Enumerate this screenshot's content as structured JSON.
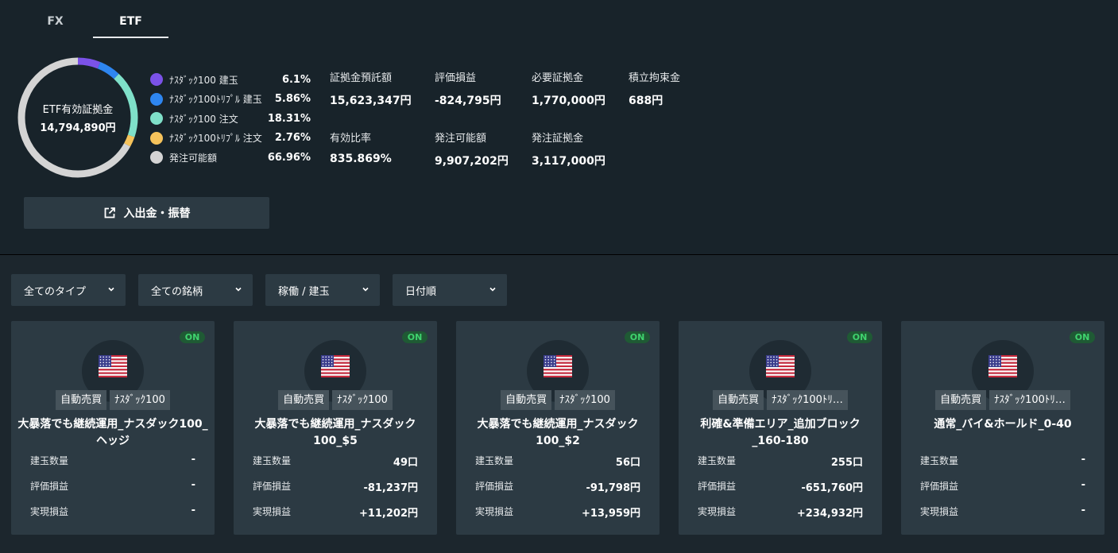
{
  "tabs": [
    {
      "label": "FX",
      "active": false
    },
    {
      "label": "ETF",
      "active": true
    }
  ],
  "donut": {
    "label": "ETF有効証拠金",
    "value": "14,794,890円",
    "segments": [
      {
        "name": "ﾅｽﾀﾞｯｸ100 建玉",
        "pct": "6.1%",
        "value": 6.1,
        "color": "#7b52e8"
      },
      {
        "name": "ﾅｽﾀﾞｯｸ100ﾄﾘﾌﾟﾙ 建玉",
        "pct": "5.86%",
        "value": 5.86,
        "color": "#2e86f0"
      },
      {
        "name": "ﾅｽﾀﾞｯｸ100 注文",
        "pct": "18.31%",
        "value": 18.31,
        "color": "#7fe0c9"
      },
      {
        "name": "ﾅｽﾀﾞｯｸ100ﾄﾘﾌﾟﾙ 注文",
        "pct": "2.76%",
        "value": 2.76,
        "color": "#f6c35b"
      },
      {
        "name": "発注可能額",
        "pct": "66.96%",
        "value": 66.96,
        "color": "#d4d4d4"
      }
    ]
  },
  "stats": {
    "deposit": {
      "label": "証拠金預託額",
      "value": "15,623,347円"
    },
    "unrealized": {
      "label": "評価損益",
      "value": "-824,795円"
    },
    "required": {
      "label": "必要証拠金",
      "value": "1,770,000円"
    },
    "reserve": {
      "label": "積立拘束金",
      "value": "688円"
    },
    "ratio": {
      "label": "有効比率",
      "value": "835.869%"
    },
    "available": {
      "label": "発注可能額",
      "value": "9,907,202円"
    },
    "order_margin": {
      "label": "発注証拠金",
      "value": "3,117,000円"
    }
  },
  "deposit_button": {
    "label": "入出金・振替",
    "icon": "external-link-icon"
  },
  "filters": [
    {
      "label": "全てのタイプ"
    },
    {
      "label": "全ての銘柄"
    },
    {
      "label": "稼働 / 建玉"
    },
    {
      "label": "日付順"
    }
  ],
  "cards": [
    {
      "status": "ON",
      "flag": "us-flag-icon",
      "tags": [
        "自動売買",
        "ﾅｽﾀﾞｯｸ100"
      ],
      "title": "大暴落でも継続運用_ナスダック100_ヘッジ",
      "rows": [
        {
          "label": "建玉数量",
          "value": "-"
        },
        {
          "label": "評価損益",
          "value": "-"
        },
        {
          "label": "実現損益",
          "value": "-"
        }
      ]
    },
    {
      "status": "ON",
      "flag": "us-flag-icon",
      "tags": [
        "自動売買",
        "ﾅｽﾀﾞｯｸ100"
      ],
      "title": "大暴落でも継続運用_ナスダック100_$5",
      "rows": [
        {
          "label": "建玉数量",
          "value": "49口"
        },
        {
          "label": "評価損益",
          "value": "-81,237円"
        },
        {
          "label": "実現損益",
          "value": "+11,202円"
        }
      ]
    },
    {
      "status": "ON",
      "flag": "us-flag-icon",
      "tags": [
        "自動売買",
        "ﾅｽﾀﾞｯｸ100"
      ],
      "title": "大暴落でも継続運用_ナスダック100_$2",
      "rows": [
        {
          "label": "建玉数量",
          "value": "56口"
        },
        {
          "label": "評価損益",
          "value": "-91,798円"
        },
        {
          "label": "実現損益",
          "value": "+13,959円"
        }
      ]
    },
    {
      "status": "ON",
      "flag": "us-flag-icon",
      "tags": [
        "自動売買",
        "ﾅｽﾀﾞｯｸ100ﾄﾘ…"
      ],
      "title": "利確&準備エリア_追加ブロック_160-180",
      "rows": [
        {
          "label": "建玉数量",
          "value": "255口"
        },
        {
          "label": "評価損益",
          "value": "-651,760円"
        },
        {
          "label": "実現損益",
          "value": "+234,932円"
        }
      ]
    },
    {
      "status": "ON",
      "flag": "us-flag-icon",
      "tags": [
        "自動売買",
        "ﾅｽﾀﾞｯｸ100ﾄﾘ…"
      ],
      "title": "通常_バイ&ホールド_0-40",
      "rows": [
        {
          "label": "建玉数量",
          "value": "-"
        },
        {
          "label": "評価損益",
          "value": "-"
        },
        {
          "label": "実現損益",
          "value": "-"
        }
      ]
    }
  ]
}
